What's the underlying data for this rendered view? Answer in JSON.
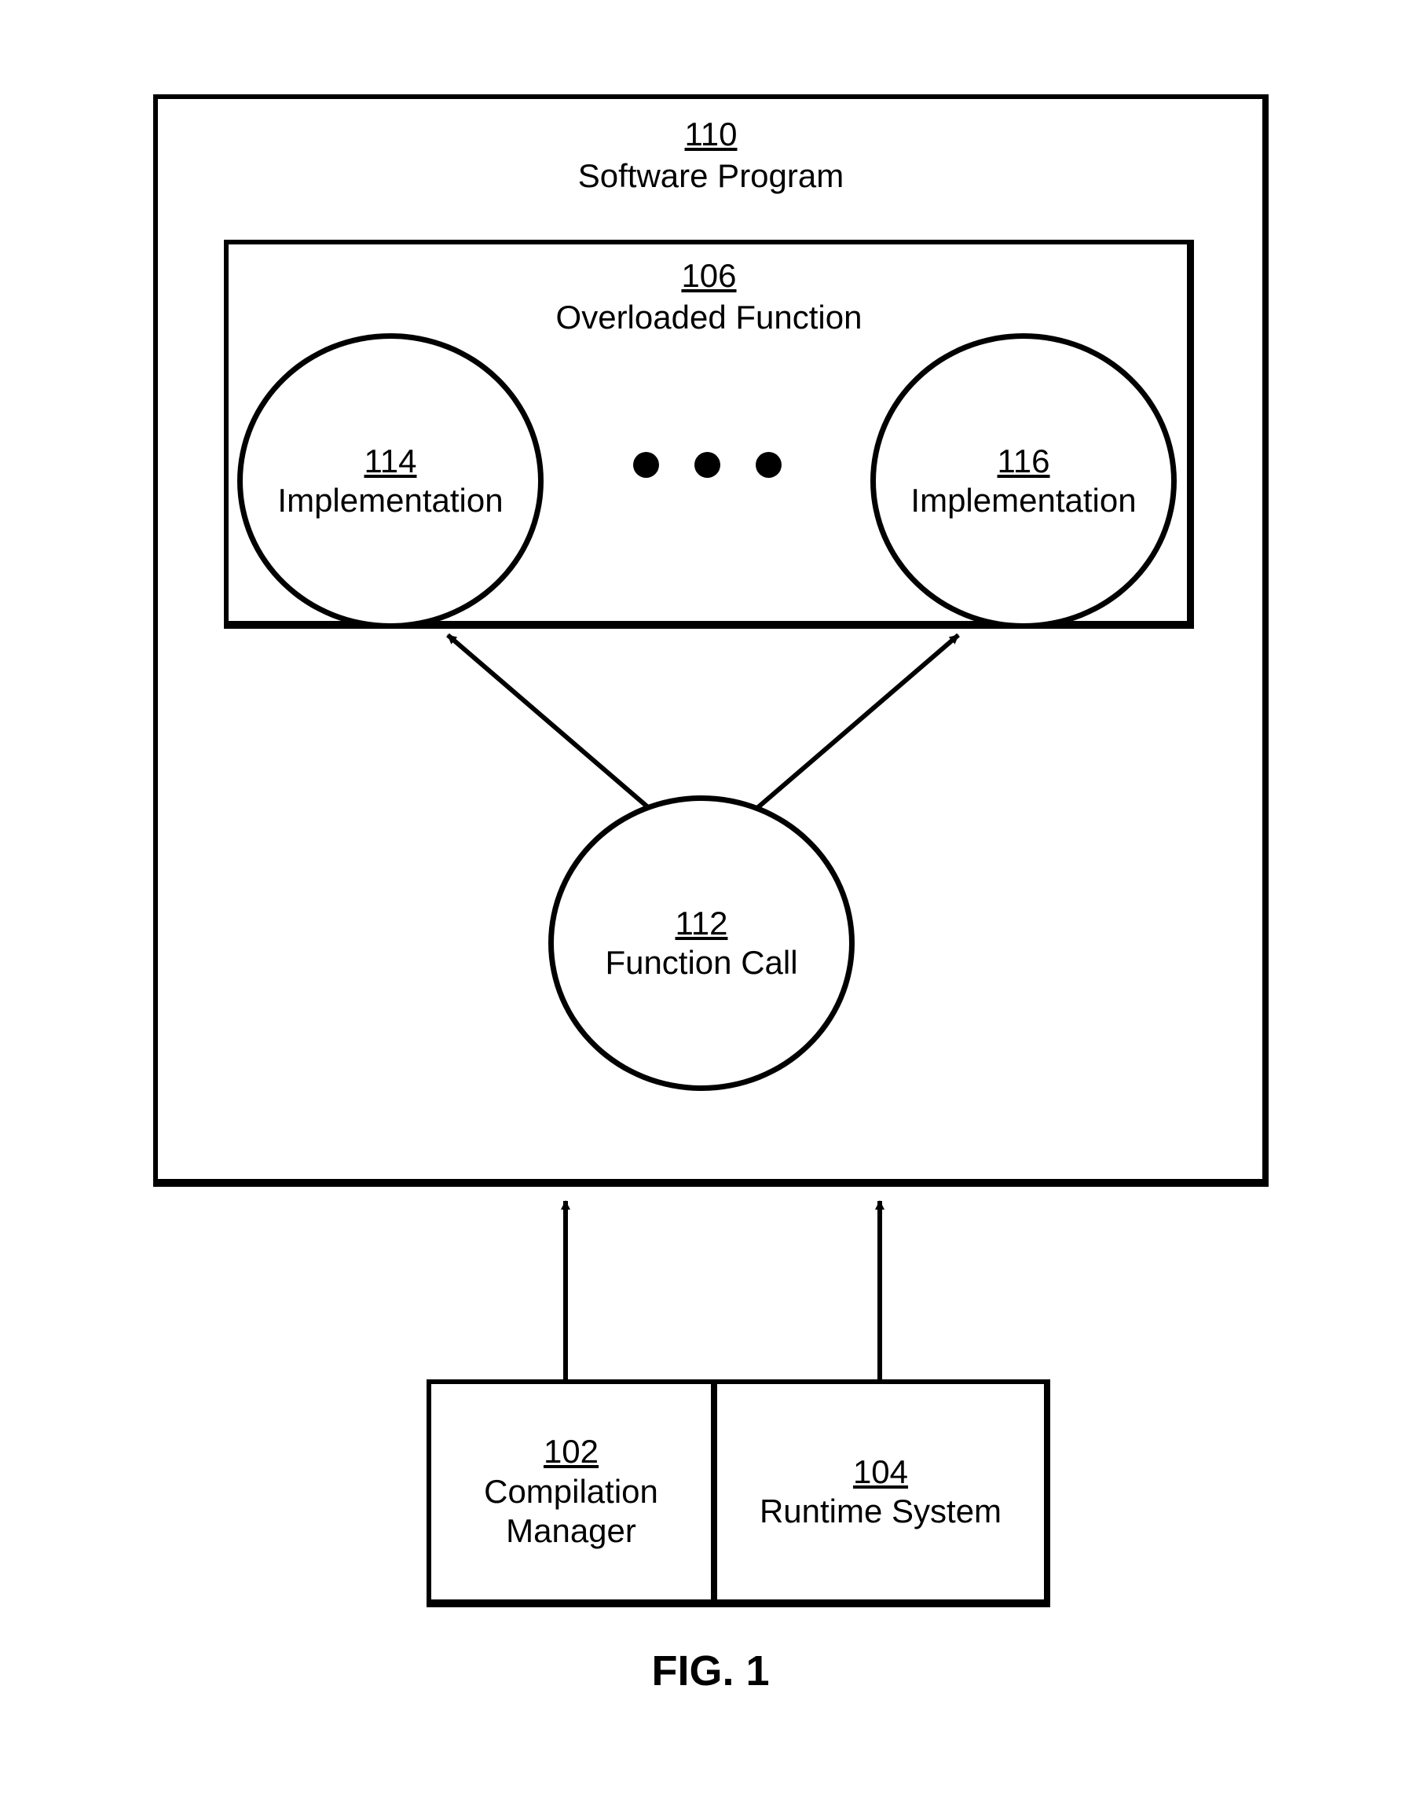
{
  "figure": {
    "caption": "FIG. 1"
  },
  "boxes": {
    "softwareProgram": {
      "num": "110",
      "label": "Software Program"
    },
    "overloadedFunction": {
      "num": "106",
      "label": "Overloaded Function"
    },
    "compilationManager": {
      "num": "102",
      "line1": "Compilation",
      "line2": "Manager"
    },
    "runtimeSystem": {
      "num": "104",
      "label": "Runtime System"
    }
  },
  "circles": {
    "impl1": {
      "num": "114",
      "label": "Implementation"
    },
    "impl2": {
      "num": "116",
      "label": "Implementation"
    },
    "functionCall": {
      "num": "112",
      "label": "Function Call"
    }
  }
}
